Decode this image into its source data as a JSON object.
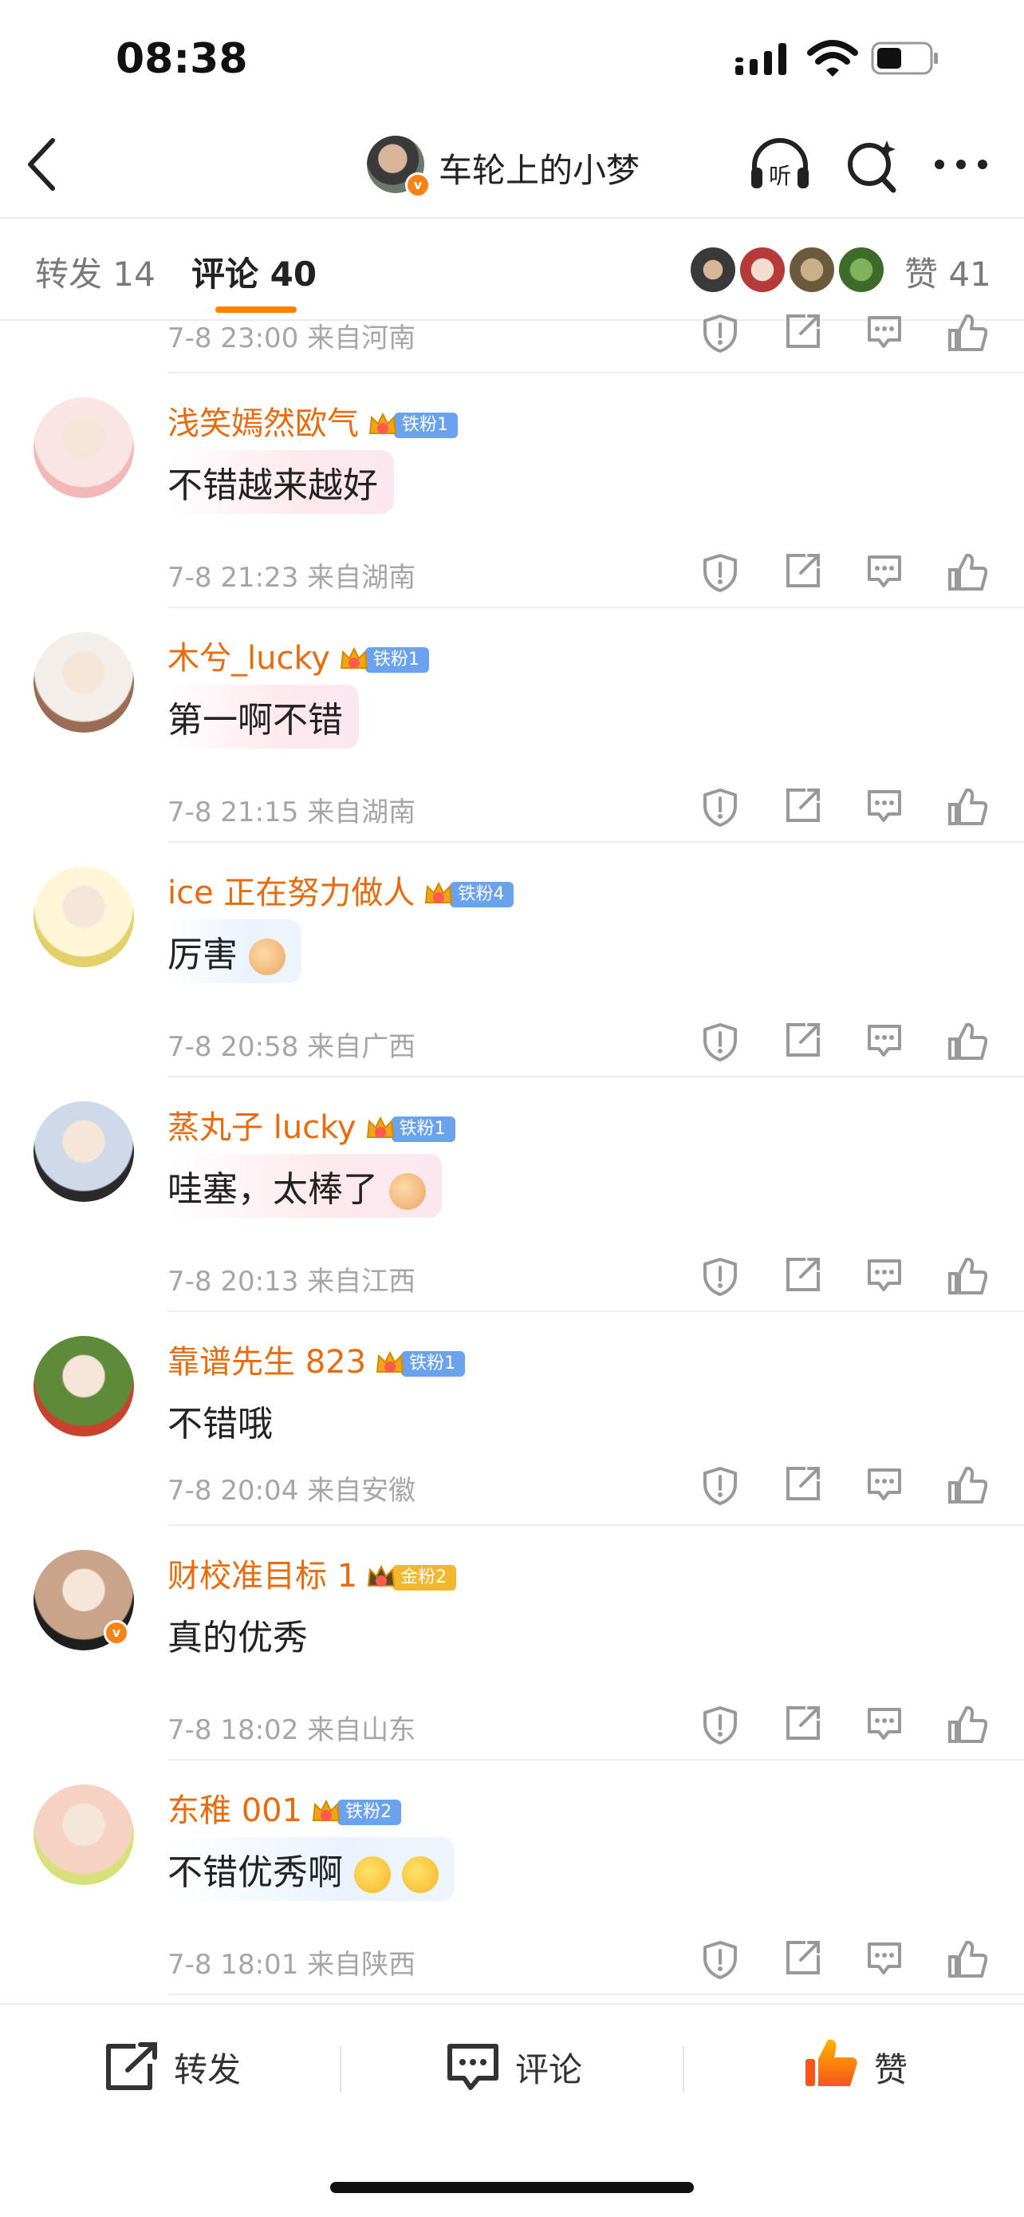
{
  "status": {
    "time": "08:38"
  },
  "nav": {
    "title": "车轮上的小梦",
    "verified": "v"
  },
  "tabs": {
    "forward": "转发 14",
    "comment": "评论 40",
    "likes": "赞 41"
  },
  "partial": {
    "meta": "7-8 23:00  来自河南"
  },
  "comments": [
    {
      "name": "浅笑嫣然欧气",
      "crown_level": "6",
      "fan": "铁粉1",
      "fan_type": "iron",
      "text": "不错越来越好",
      "meta": "7-8 21:23  来自湖南",
      "avatar_colors": [
        "#fbe4e4",
        "#f2b8b8"
      ]
    },
    {
      "name": "木兮_lucky",
      "crown_level": "",
      "fan": "铁粉1",
      "fan_type": "iron",
      "text": "第一啊不错",
      "meta": "7-8 21:15  来自湖南",
      "avatar_colors": [
        "#f3eee9",
        "#9a6b55"
      ]
    },
    {
      "name": "ice 正在努力做人",
      "crown_level": "2",
      "fan": "铁粉4",
      "fan_type": "iron",
      "text": "厉害",
      "emoji": "thumbs-up",
      "meta": "7-8 20:58  来自广西",
      "avatar_colors": [
        "#fff6d8",
        "#e4d06a"
      ]
    },
    {
      "name": "蒸丸子 lucky",
      "crown_level": "",
      "fan": "铁粉1",
      "fan_type": "iron",
      "text": "哇塞，太棒了",
      "emoji": "thumbs-up",
      "meta": "7-8 20:13  来自江西",
      "avatar_colors": [
        "#cfd9e9",
        "#2a2a2a"
      ]
    },
    {
      "name": "靠谱先生 823",
      "crown_level": "6",
      "fan": "铁粉1",
      "fan_type": "iron",
      "text": "不错哦",
      "meta": "7-8 20:04  来自安徽",
      "avatar_colors": [
        "#5e8a3a",
        "#c8432e"
      ]
    },
    {
      "name": "财校准目标 1",
      "crown_level": "",
      "fan": "金粉2",
      "fan_type": "gold",
      "text": "真的优秀",
      "meta": "7-8 18:02  来自山东",
      "avatar_colors": [
        "#c9a48a",
        "#1e1e1e"
      ],
      "verified": "v"
    },
    {
      "name": "东稚 001",
      "crown_level": "",
      "fan": "铁粉2",
      "fan_type": "iron",
      "text": "不错优秀啊",
      "emoji": "heart-face",
      "meta": "7-8 18:01  来自陕西",
      "avatar_colors": [
        "#f6d2c2",
        "#d7e07a"
      ]
    }
  ],
  "bottom": {
    "forward": "转发",
    "comment": "评论",
    "like": "赞"
  },
  "colors": {
    "accent": "#ff8200",
    "username": "#e86b0e",
    "iron_fan": "#6aa2ee",
    "gold_fan": "#f3b62f",
    "like_active": "#f75a1c"
  }
}
